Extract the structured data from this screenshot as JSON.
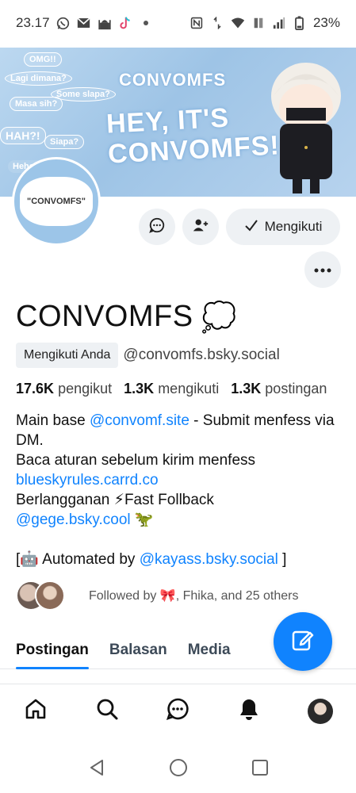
{
  "status_bar": {
    "time": "23.17",
    "battery": "23%",
    "left_icons": [
      "whatsapp-icon",
      "mail-icon",
      "mosque-icon",
      "tiktok-icon",
      "dot-icon"
    ],
    "right_icons": [
      "nfc-icon",
      "data-arrows-icon",
      "wifi-icon",
      "volte-icon",
      "signal-icon",
      "battery-icon"
    ]
  },
  "banner": {
    "title_small": "CONVOMFS",
    "title_large_line1": "HEY, IT'S",
    "title_large_line2": "CONVOMFS!",
    "doodles": [
      "OMG!!",
      "Lagi dimana?",
      "Masa sih?",
      "Siapa?",
      "Some slapa?",
      "HAH?!",
      "Hehehe"
    ]
  },
  "profile": {
    "avatar_text": "\"CONVOMFS\"",
    "display_name": "CONVOMFS",
    "name_emoji": "💭",
    "follows_you_badge": "Mengikuti Anda",
    "handle": "@convomfs.bsky.social",
    "follow_button": "Mengikuti",
    "stats": {
      "followers_count": "17.6K",
      "followers_label": "pengikut",
      "following_count": "1.3K",
      "following_label": "mengikuti",
      "posts_count": "1.3K",
      "posts_label": "postingan"
    },
    "bio": {
      "line1_pre": "Main base ",
      "line1_link": "@convomf.site",
      "line1_post": " - Submit menfess via DM.",
      "line2": "Baca aturan sebelum kirim menfess",
      "line3_link": "blueskyrules.carrd.co",
      "line4": "Berlangganan ⚡Fast Follback",
      "line5_link": "@gege.bsky.cool",
      "line5_emoji": "🦖",
      "line6_pre": "[🤖 Automated by ",
      "line6_link": "@kayass.bsky.social",
      "line6_post": " ]"
    },
    "followed_by": "Followed by 🎀, Fhika, and 25 others"
  },
  "tabs": [
    "Postingan",
    "Balasan",
    "Media"
  ],
  "active_tab": "Postingan",
  "colors": {
    "accent": "#1083fe",
    "button_bg": "#eef1f4",
    "banner_blue": "#9ec4e6"
  },
  "bottom_nav": [
    "home-icon",
    "search-icon",
    "chat-icon",
    "notifications-icon",
    "profile-avatar"
  ],
  "system_nav": [
    "back-icon",
    "home-circle-icon",
    "recents-icon"
  ]
}
